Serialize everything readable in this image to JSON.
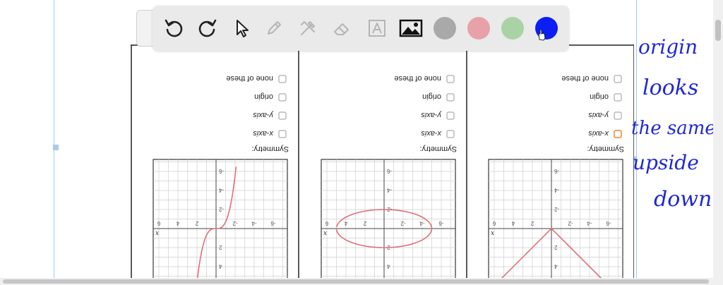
{
  "toolbar": {
    "tools": [
      "undo-icon",
      "redo-icon",
      "select-pointer-icon",
      "pen-icon",
      "tools-icon",
      "eraser-icon",
      "text-icon",
      "image-icon"
    ],
    "colors": [
      "#a9a9a9",
      "#e8a1a8",
      "#a9d3a5",
      "#0a1ef5"
    ],
    "active_color": "#0a1ef5"
  },
  "worksheet": {
    "symmetry_label": "Symmetry:",
    "options": [
      "x-axis",
      "y-axis",
      "origin",
      "none of these"
    ],
    "graph_x_label": "x",
    "tick_labels": [
      "-6",
      "-4",
      "-2",
      "2",
      "4",
      "6"
    ],
    "problems": [
      {
        "graph": "absolute-value",
        "checked": [
          false,
          false,
          false,
          false
        ],
        "highlighted": [
          true,
          false,
          false,
          false
        ]
      },
      {
        "graph": "ellipse",
        "checked": [
          false,
          false,
          false,
          false
        ],
        "highlighted": [
          false,
          false,
          false,
          false
        ]
      },
      {
        "graph": "cubic",
        "checked": [
          false,
          false,
          false,
          false
        ],
        "highlighted": [
          false,
          false,
          false,
          false
        ]
      }
    ]
  },
  "annotation": {
    "lines": [
      "origin",
      "looks",
      "the same",
      "upside",
      "down"
    ],
    "ink_color": "#1f28d6"
  }
}
